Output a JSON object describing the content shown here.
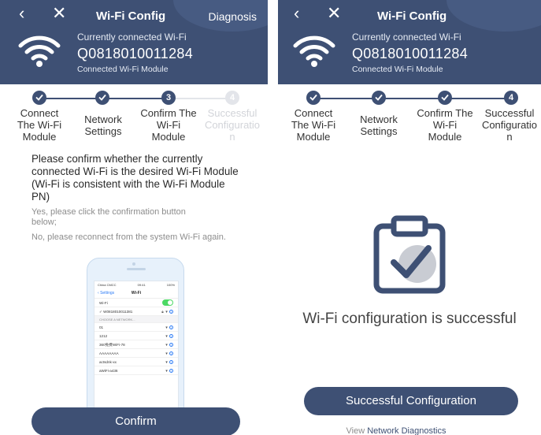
{
  "left": {
    "header": {
      "title": "Wi-Fi Config",
      "diagnosis_label": "Diagnosis",
      "connected_label": "Currently connected Wi-Fi",
      "wifi_id": "Q0818010011284",
      "module_type": "Connected Wi-Fi Module"
    },
    "steps": [
      {
        "number": "1",
        "label": "Connect The Wi-Fi Module",
        "state": "done"
      },
      {
        "number": "2",
        "label": "Network Settings",
        "state": "done"
      },
      {
        "number": "3",
        "label": "Confirm The Wi-Fi Module",
        "state": "current"
      },
      {
        "number": "4",
        "label": "Successful Configuratio n",
        "state": "pending"
      }
    ],
    "confirm_text": "Please confirm whether the currently connected Wi-Fi is the desired Wi-Fi Module (Wi-Fi is consistent with the Wi-Fi Module PN)",
    "hint_yes": "Yes, please click the confirmation button below;",
    "hint_no": "No, please reconnect from the system Wi-Fi again.",
    "phone_mock": {
      "carrier": "China CMCC",
      "time": "09:41",
      "battery": "100%",
      "back_label": "Settings",
      "title": "Wi-Fi",
      "wifi_row": "Wi-Fi",
      "connected_network": "W0818010011381",
      "section_label": "CHOOSE A NETWORK...",
      "networks": [
        "01",
        "1212",
        "360免费WiFi-78",
        "AAAAAAAA",
        "actsdnk-xx",
        "aWiFi-a436"
      ]
    },
    "confirm_button": "Confirm"
  },
  "right": {
    "header": {
      "title": "Wi-Fi Config",
      "connected_label": "Currently connected Wi-Fi",
      "wifi_id": "Q0818010011284",
      "module_type": "Connected Wi-Fi Module"
    },
    "steps": [
      {
        "number": "1",
        "label": "Connect The Wi-Fi Module",
        "state": "done"
      },
      {
        "number": "2",
        "label": "Network Settings",
        "state": "done"
      },
      {
        "number": "3",
        "label": "Confirm The Wi-Fi Module",
        "state": "done"
      },
      {
        "number": "4",
        "label": "Successful Configuratio n",
        "state": "current"
      }
    ],
    "success_text": "Wi-Fi configuration is successful",
    "success_button": "Successful Configuration",
    "diagnostics_prefix": "View",
    "diagnostics_link": "Network Diagnostics"
  },
  "icons": {
    "back": "chevron-left-icon",
    "close": "close-icon",
    "wifi": "wifi-icon",
    "check": "check-icon",
    "clipboard": "clipboard-check-icon"
  },
  "colors": {
    "primary": "#3e5074",
    "pending": "#e3e5ea",
    "success_check_bg": "#c9ccd3"
  }
}
